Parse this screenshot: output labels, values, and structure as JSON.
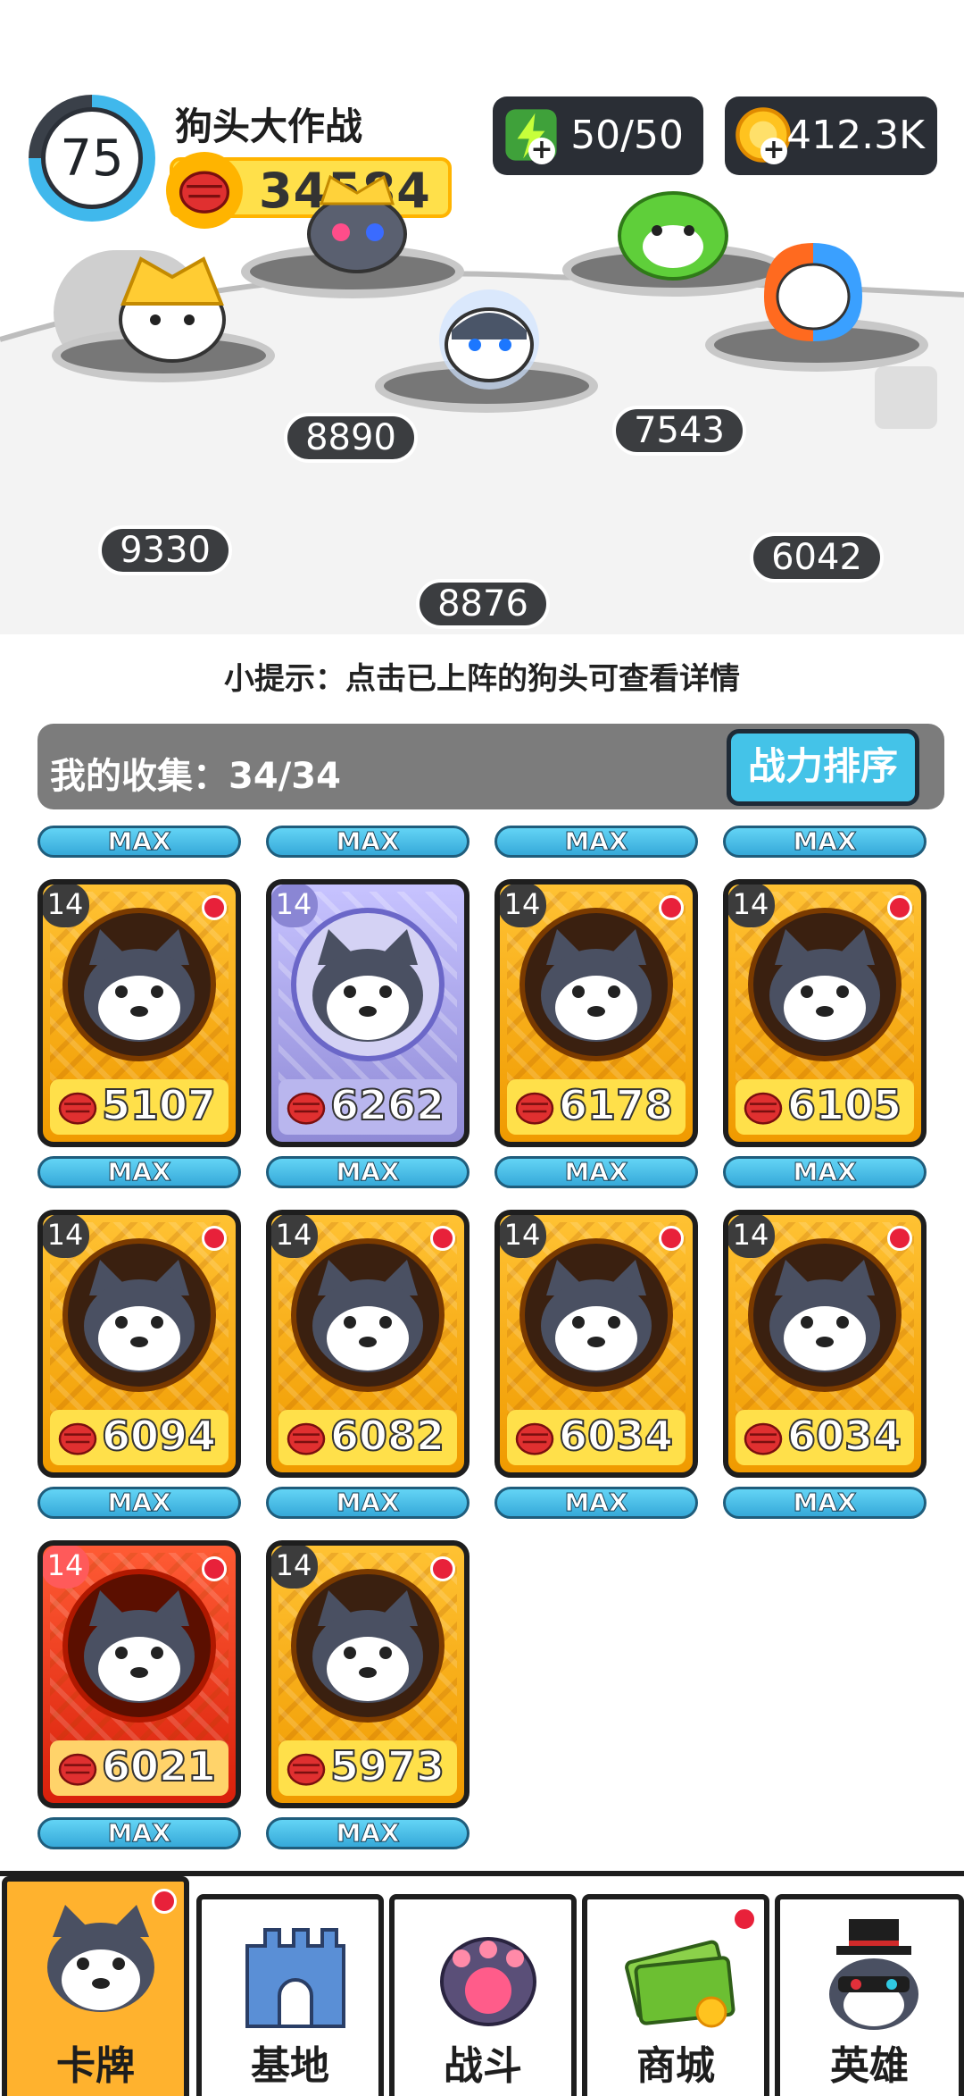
{
  "player": {
    "level": "75",
    "name": "狗头大作战",
    "power": "34584"
  },
  "resources": {
    "energy": "50/50",
    "coins": "412.3K"
  },
  "lineup": [
    {
      "score": "9330"
    },
    {
      "score": "8890"
    },
    {
      "score": "8876"
    },
    {
      "score": "7543"
    },
    {
      "score": "6042"
    }
  ],
  "tip": "小提示：点击已上阵的狗头可查看详情",
  "collection": {
    "label": "我的收集：34/34",
    "sort_button": "战力排序"
  },
  "max_label": "MAX",
  "cards": [
    {
      "level": "14",
      "power": "5107",
      "style": "gold"
    },
    {
      "level": "14",
      "power": "6262",
      "style": "purple"
    },
    {
      "level": "14",
      "power": "6178",
      "style": "gold"
    },
    {
      "level": "14",
      "power": "6105",
      "style": "gold"
    },
    {
      "level": "14",
      "power": "6094",
      "style": "gold"
    },
    {
      "level": "14",
      "power": "6082",
      "style": "gold"
    },
    {
      "level": "14",
      "power": "6034",
      "style": "gold"
    },
    {
      "level": "14",
      "power": "6034",
      "style": "gold"
    },
    {
      "level": "14",
      "power": "6021",
      "style": "red"
    },
    {
      "level": "14",
      "power": "5973",
      "style": "gold"
    }
  ],
  "nav": [
    {
      "label": "卡牌",
      "icon": "husky-card-icon",
      "active": true
    },
    {
      "label": "基地",
      "icon": "castle-icon",
      "active": false
    },
    {
      "label": "战斗",
      "icon": "paw-icon",
      "active": false
    },
    {
      "label": "商城",
      "icon": "money-shop-icon",
      "active": false
    },
    {
      "label": "英雄",
      "icon": "hero-dog-icon",
      "active": false
    }
  ],
  "colors": {
    "accent_blue": "#44c3e8",
    "gold": "#ffb400",
    "badge_red": "#e8213a",
    "nav_active": "#ffb22e"
  }
}
